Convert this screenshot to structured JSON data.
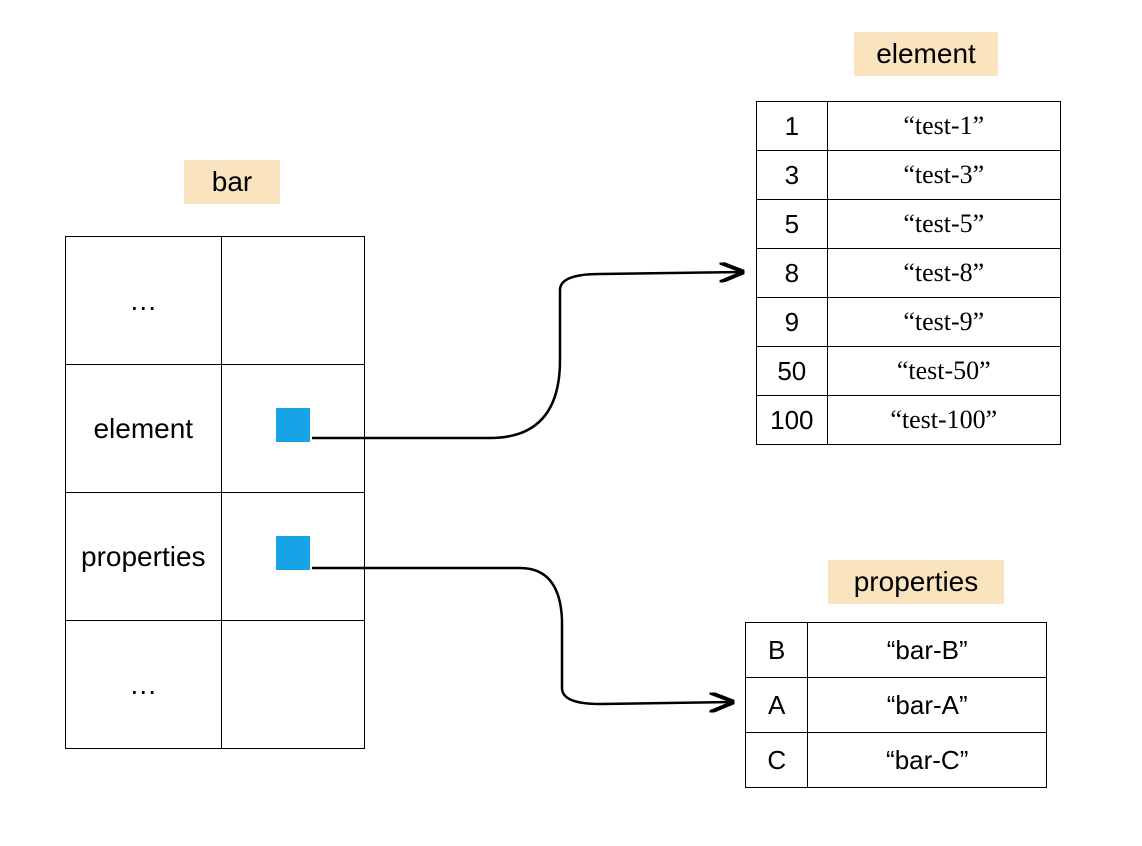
{
  "headers": {
    "bar": "bar",
    "element": "element",
    "properties": "properties"
  },
  "bar_rows": [
    {
      "key": "…",
      "val_type": "empty"
    },
    {
      "key": "element",
      "val_type": "ref"
    },
    {
      "key": "properties",
      "val_type": "ref"
    },
    {
      "key": "…",
      "val_type": "empty"
    }
  ],
  "element_rows": [
    {
      "k": "1",
      "v": "“test-1”"
    },
    {
      "k": "3",
      "v": "“test-3”"
    },
    {
      "k": "5",
      "v": "“test-5”"
    },
    {
      "k": "8",
      "v": "“test-8”"
    },
    {
      "k": "9",
      "v": "“test-9”"
    },
    {
      "k": "50",
      "v": "“test-50”"
    },
    {
      "k": "100",
      "v": "“test-100”"
    }
  ],
  "properties_rows": [
    {
      "k": "B",
      "v": "“bar-B”"
    },
    {
      "k": "A",
      "v": "“bar-A”"
    },
    {
      "k": "C",
      "v": "“bar-C”"
    }
  ]
}
